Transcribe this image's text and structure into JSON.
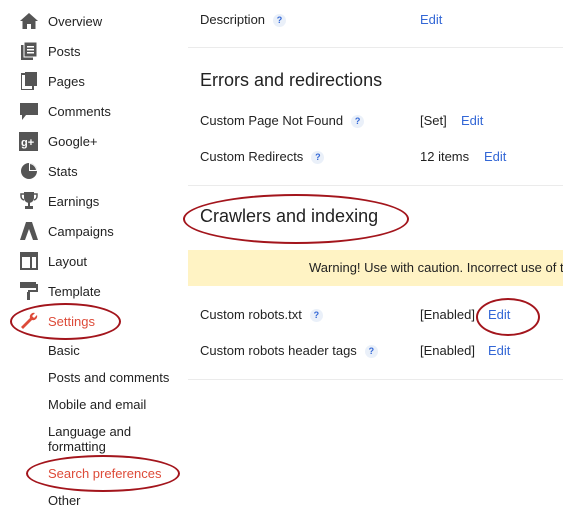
{
  "sidebar": {
    "items": [
      {
        "label": "Overview",
        "icon": "home-icon"
      },
      {
        "label": "Posts",
        "icon": "posts-icon"
      },
      {
        "label": "Pages",
        "icon": "pages-icon"
      },
      {
        "label": "Comments",
        "icon": "comments-icon"
      },
      {
        "label": "Google+",
        "icon": "google-plus-icon"
      },
      {
        "label": "Stats",
        "icon": "stats-icon"
      },
      {
        "label": "Earnings",
        "icon": "trophy-icon"
      },
      {
        "label": "Campaigns",
        "icon": "campaigns-icon"
      },
      {
        "label": "Layout",
        "icon": "layout-icon"
      },
      {
        "label": "Template",
        "icon": "template-icon"
      },
      {
        "label": "Settings",
        "icon": "wrench-icon"
      }
    ],
    "sub_items": [
      {
        "label": "Basic"
      },
      {
        "label": "Posts and comments"
      },
      {
        "label": "Mobile and email"
      },
      {
        "label": "Language and formatting"
      },
      {
        "label": "Search preferences"
      },
      {
        "label": "Other"
      }
    ]
  },
  "main": {
    "description": {
      "label": "Description",
      "help": "?",
      "edit": "Edit"
    },
    "errors": {
      "title": "Errors and redirections",
      "rows": [
        {
          "label": "Custom Page Not Found",
          "help": "?",
          "value": "[Set]",
          "edit": "Edit"
        },
        {
          "label": "Custom Redirects",
          "help": "?",
          "value": "12 items",
          "edit": "Edit"
        }
      ]
    },
    "crawlers": {
      "title": "Crawlers and indexing",
      "warning": "Warning! Use with caution. Incorrect use of t",
      "rows": [
        {
          "label": "Custom robots.txt",
          "help": "?",
          "value": "[Enabled]",
          "edit": "Edit"
        },
        {
          "label": "Custom robots header tags",
          "help": "?",
          "value": "[Enabled]",
          "edit": "Edit"
        }
      ]
    }
  },
  "colors": {
    "accent": "#dd4b39",
    "link": "#3367d6",
    "warning_bg": "#fff3c4",
    "annotation": "#a3151c"
  }
}
